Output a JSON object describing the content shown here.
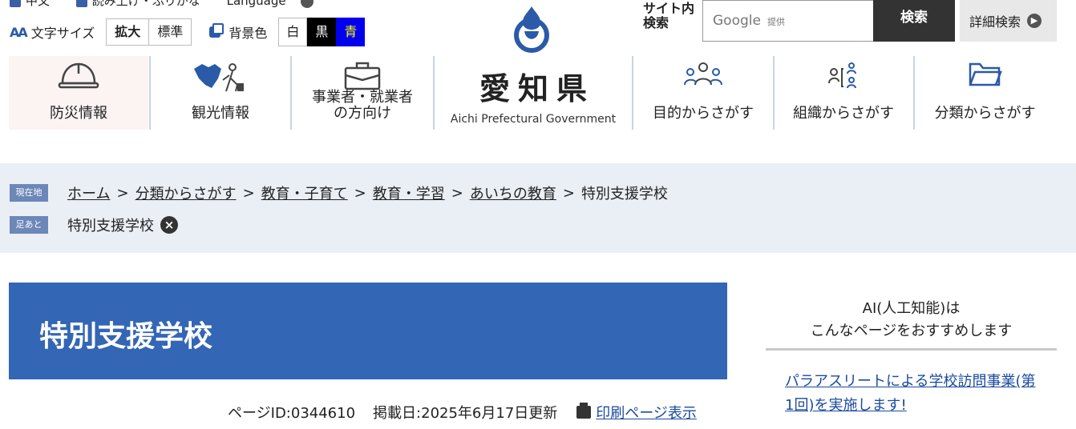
{
  "utility": {
    "top_cut": [
      "中文",
      "読み上げ・ふりがな",
      "Language"
    ],
    "font_size_label": "文字サイズ",
    "font_size_options": [
      "拡大",
      "標準"
    ],
    "bg_label": "背景色",
    "bg_options": [
      "白",
      "黒",
      "青"
    ]
  },
  "search": {
    "label": "サイト内検索",
    "provider": "Google",
    "provider_suffix": "提供",
    "button": "検索",
    "advanced": "詳細検索"
  },
  "logo": {
    "name": "愛知県",
    "english": "Aichi Prefectural Government"
  },
  "nav": {
    "disaster": "防災情報",
    "tourism": "観光情報",
    "business": "事業者・就業者の方向け",
    "purpose": "目的からさがす",
    "organization": "組織からさがす",
    "category": "分類からさがす"
  },
  "breadcrumb": {
    "current_tag": "現在地",
    "links": [
      "ホーム",
      "分類からさがす",
      "教育・子育て",
      "教育・学習",
      "あいちの教育"
    ],
    "current": "特別支援学校",
    "separator": ">"
  },
  "history": {
    "tag": "足あと",
    "item": "特別支援学校",
    "remove": "×"
  },
  "page": {
    "title": "特別支援学校",
    "page_id": "ページID:0344610",
    "posted": "掲載日:2025年6月17日更新",
    "print": "印刷ページ表示"
  },
  "ai": {
    "heading_line1": "AI(人工知能)は",
    "heading_line2": "こんなページをおすすめします",
    "recommend": "パラアスリートによる学校訪問事業(第1回)を実施します!"
  },
  "colors": {
    "title_bar": "#3366b5",
    "crumb_band": "#eaeff6",
    "link": "#1a4a9e"
  }
}
